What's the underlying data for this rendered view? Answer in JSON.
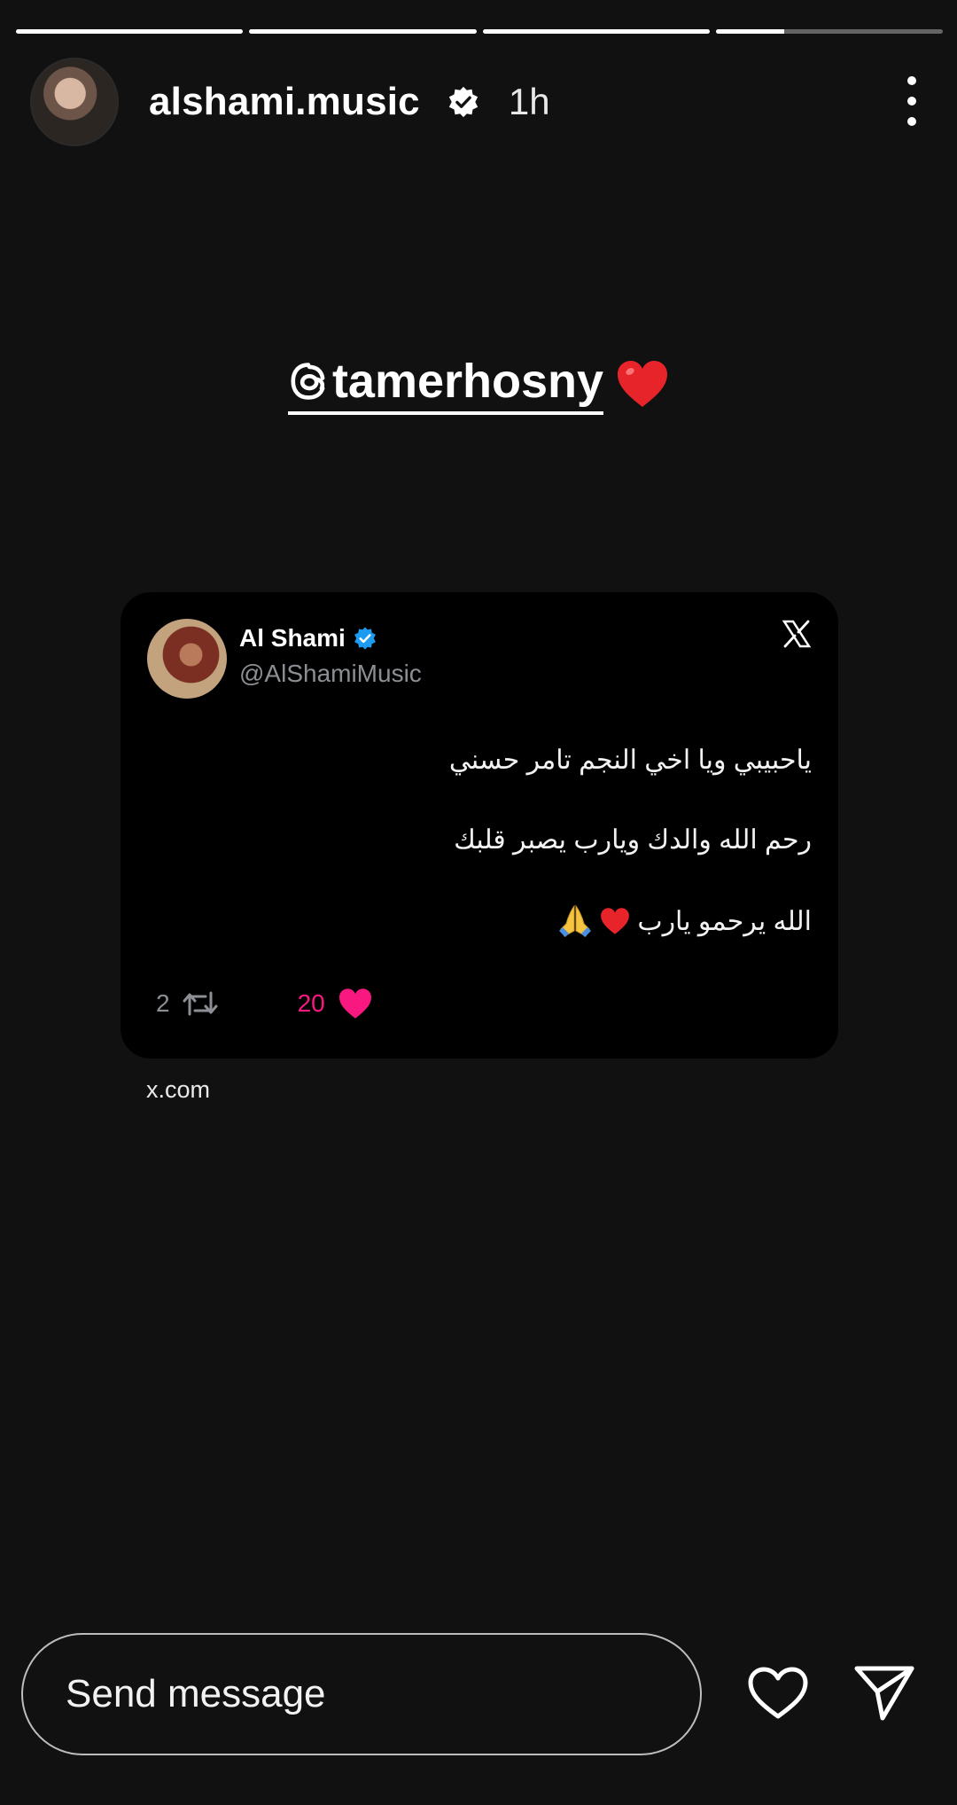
{
  "story": {
    "progress_segments": [
      1,
      1,
      1,
      0.3
    ],
    "username": "alshami.music",
    "time": "1h",
    "mention": "tamerhosny"
  },
  "tweet": {
    "name": "Al Shami",
    "handle": "@AlShamiMusic",
    "lines": [
      "ياحبيبي ويا اخي النجم تامر حسني",
      "رحم الله والدك ويارب يصبر قلبك",
      "الله يرحمو يارب"
    ],
    "retweets": "2",
    "likes": "20",
    "source": "x.com"
  },
  "composer": {
    "placeholder": "Send message"
  },
  "colors": {
    "background": "#111112",
    "like_pink": "#f91880",
    "verified_blue": "#1d9bf0"
  }
}
